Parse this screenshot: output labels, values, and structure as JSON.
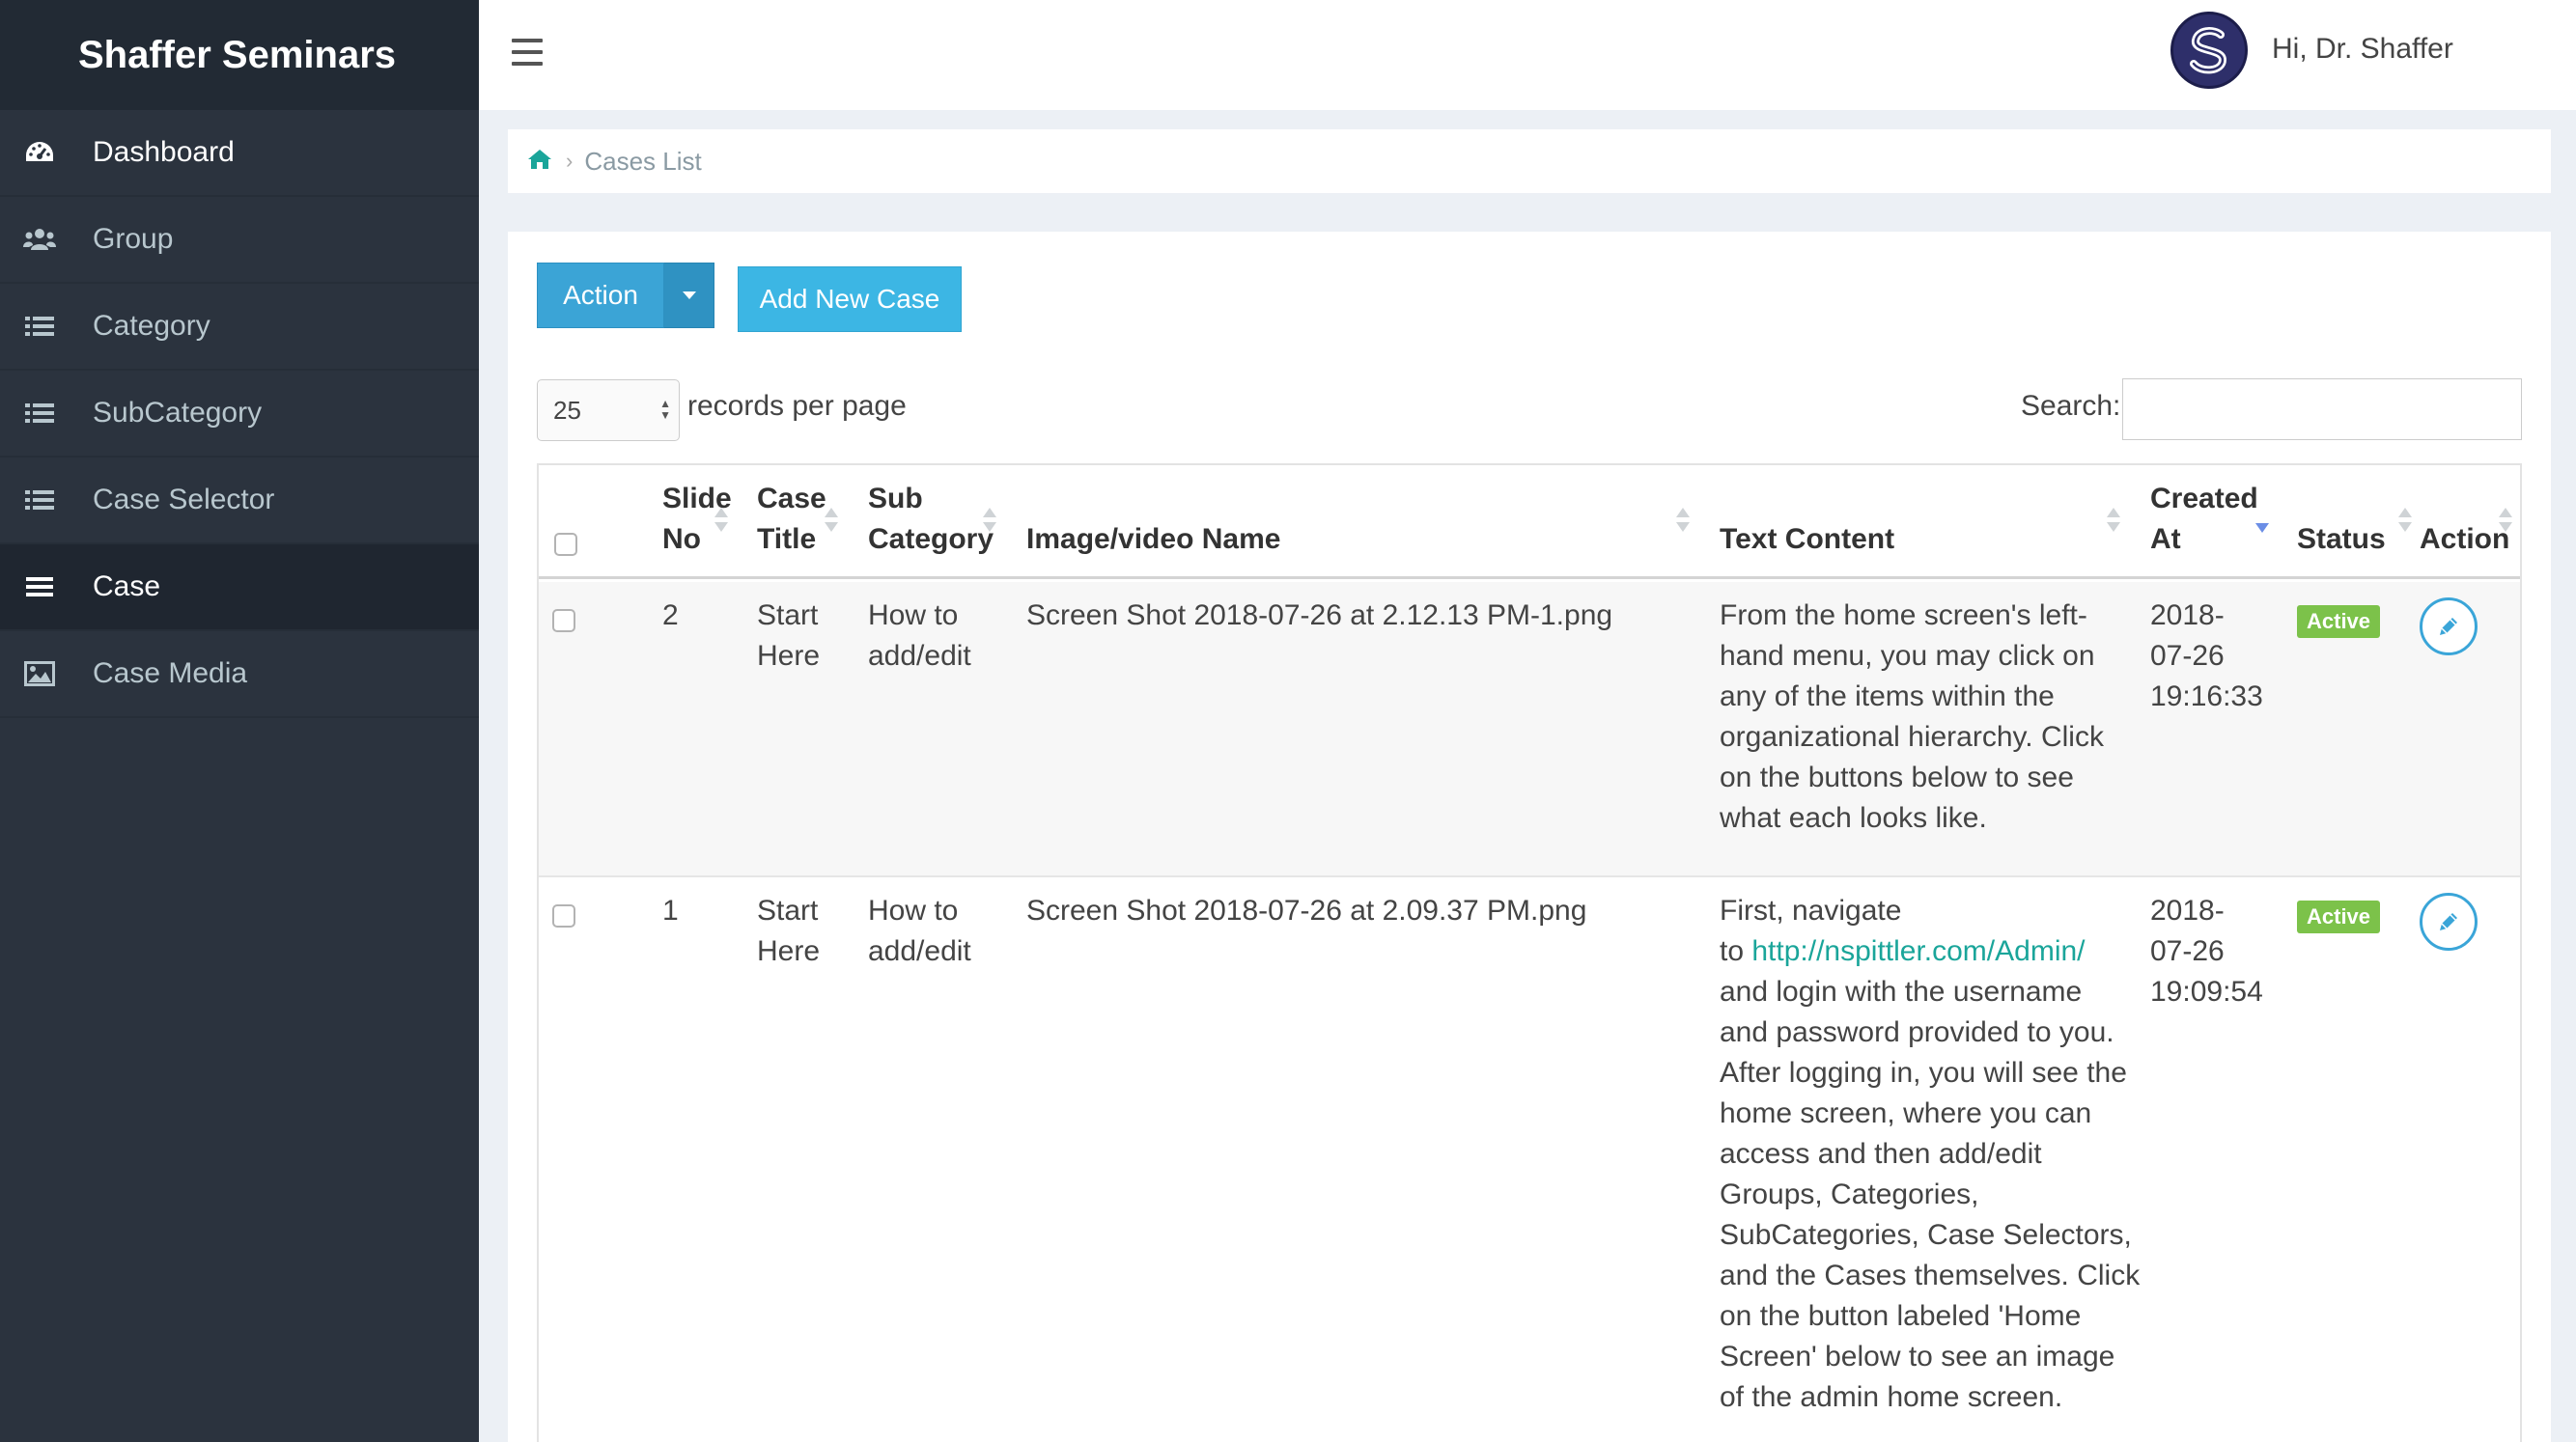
{
  "sidebar": {
    "brand": "Shaffer Seminars",
    "items": [
      {
        "label": "Dashboard",
        "icon": "dashboard-icon"
      },
      {
        "label": "Group",
        "icon": "users-icon"
      },
      {
        "label": "Category",
        "icon": "list-icon"
      },
      {
        "label": "SubCategory",
        "icon": "list-icon"
      },
      {
        "label": "Case Selector",
        "icon": "list-icon"
      },
      {
        "label": "Case",
        "icon": "bars-icon"
      },
      {
        "label": "Case Media",
        "icon": "image-icon"
      }
    ]
  },
  "header": {
    "user_greeting": "Hi, Dr. Shaffer"
  },
  "breadcrumb": {
    "current": "Cases List"
  },
  "toolbar": {
    "action_label": "Action",
    "add_label": "Add New Case"
  },
  "records": {
    "value": "25",
    "label": "records per page"
  },
  "search": {
    "label": "Search:",
    "value": ""
  },
  "table": {
    "headers": {
      "slide_no_1": "Slide",
      "slide_no_2": "No",
      "case_title_1": "Case",
      "case_title_2": "Title",
      "sub_category_1": "Sub",
      "sub_category_2": "Category",
      "image_name": "Image/video Name",
      "text_content": "Text Content",
      "created_at_1": "Created",
      "created_at_2": "At",
      "status": "Status",
      "action": "Action"
    },
    "rows": [
      {
        "slide_no": "2",
        "title_1": "Start",
        "title_2": "Here",
        "sub_1": "How to",
        "sub_2": "add/edit",
        "image": "Screen Shot 2018-07-26 at 2.12.13 PM-1.png",
        "text_lines": [
          "From the home screen's left-",
          "hand menu, you may click on",
          "any of the items within the",
          "organizational hierarchy. Click",
          "on the buttons below to see",
          "what each looks like."
        ],
        "created_1": "2018-",
        "created_2": "07-26",
        "created_3": "19:16:33",
        "status": "Active"
      },
      {
        "slide_no": "1",
        "title_1": "Start",
        "title_2": "Here",
        "sub_1": "How to",
        "sub_2": "add/edit",
        "image": "Screen Shot 2018-07-26 at 2.09.37 PM.png",
        "text_first": "First, navigate",
        "text_to": "to ",
        "text_link": "http://nspittler.com/Admin/",
        "text_lines": [
          "and login with the username",
          "and password provided to you.",
          "After logging in, you will see the",
          "home screen, where you can",
          "access and then add/edit",
          "Groups, Categories,",
          "SubCategories, Case Selectors,",
          "and the Cases themselves. Click",
          "on the button labeled 'Home",
          "Screen' below to see an image",
          "of the admin home screen."
        ],
        "created_1": "2018-",
        "created_2": "07-26",
        "created_3": "19:09:54",
        "status": "Active"
      }
    ]
  },
  "colors": {
    "sidebar_bg": "#2b333e",
    "primary": "#3ba4d6",
    "active_badge": "#7cc24a",
    "link": "#1aa59a"
  }
}
